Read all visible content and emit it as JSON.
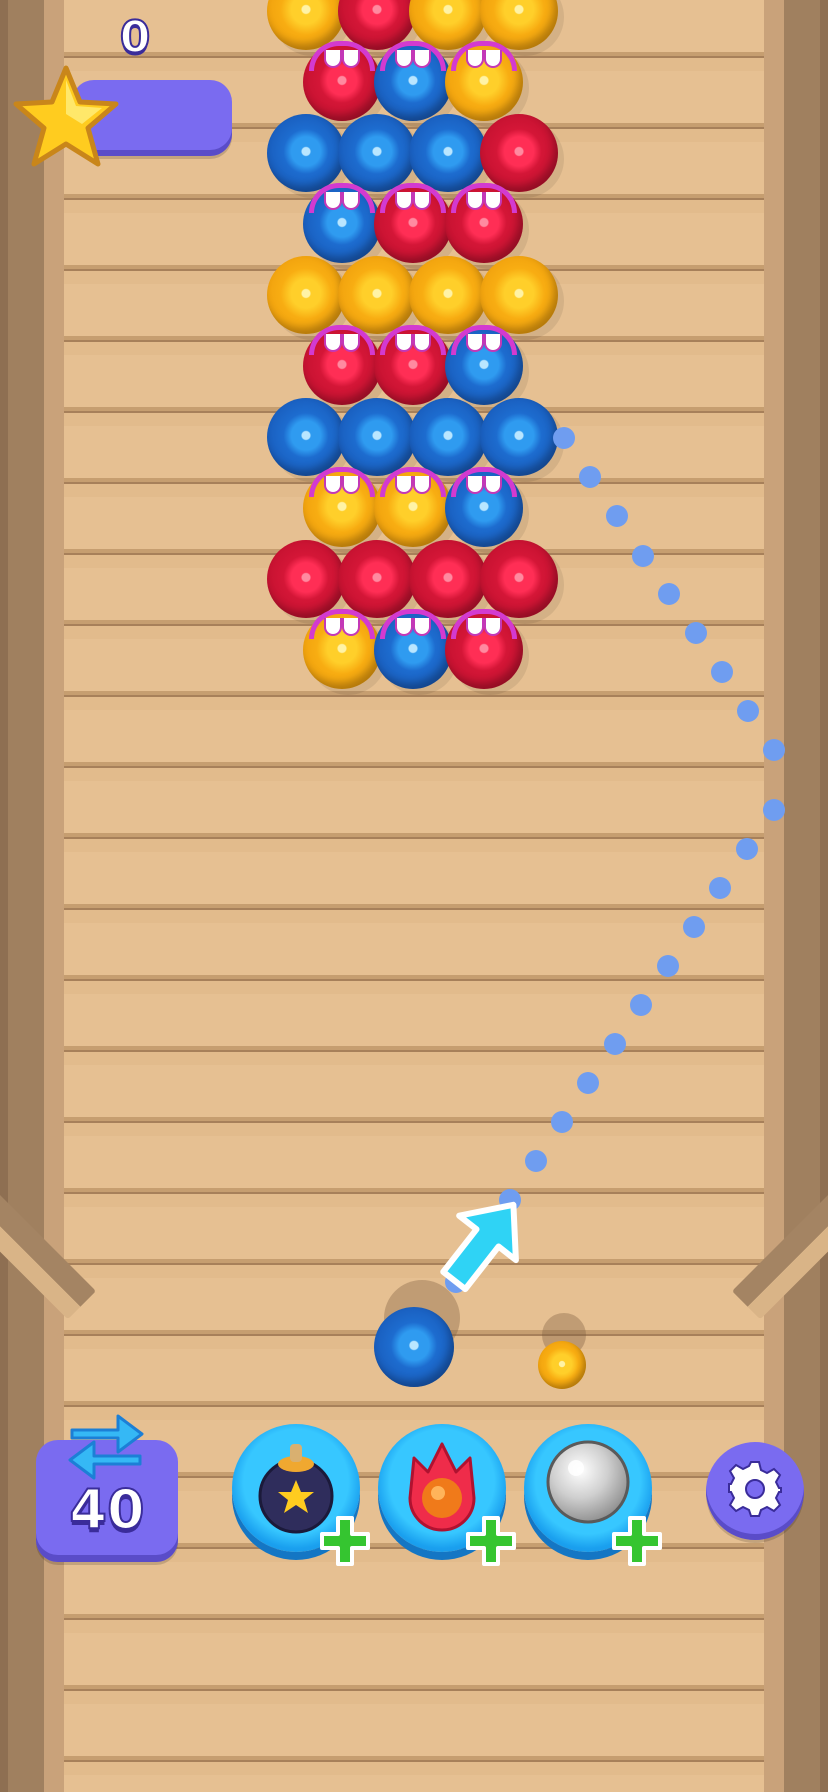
{
  "hud": {
    "score": "0",
    "swaps_remaining": "40"
  },
  "icons": {
    "score": "star-icon",
    "swap": "swap-arrows-icon",
    "settings": "gear-icon",
    "aim": "aim-arrow-icon"
  },
  "powerups": [
    {
      "name": "bomb",
      "icon": "bomb-icon",
      "add_icon": "plus-icon"
    },
    {
      "name": "fire",
      "icon": "fireball-icon",
      "add_icon": "plus-icon"
    },
    {
      "name": "silver",
      "icon": "silver-ball-icon",
      "add_icon": "plus-icon"
    }
  ],
  "shooter": {
    "current_ball": "blue",
    "next_ball": "yellow"
  },
  "bubble_grid": [
    [
      "yellow",
      "red",
      "yellow",
      "yellow"
    ],
    [
      "red-fanged",
      "blue-fanged",
      "yellow-fanged"
    ],
    [
      "blue",
      "blue",
      "blue",
      "red"
    ],
    [
      "blue-fanged",
      "red-fanged",
      "red-fanged"
    ],
    [
      "yellow",
      "yellow",
      "yellow",
      "yellow"
    ],
    [
      "red-fanged",
      "red-fanged",
      "blue-fanged"
    ],
    [
      "blue",
      "blue",
      "blue",
      "blue"
    ],
    [
      "yellow-fanged",
      "yellow-fanged",
      "blue-fanged"
    ],
    [
      "red",
      "red",
      "red",
      "red"
    ],
    [
      "yellow-fanged",
      "blue-fanged",
      "red-fanged"
    ]
  ],
  "colors": {
    "red": "#d41637",
    "blue": "#1d6ccf",
    "yellow": "#f8ad12",
    "panel": "#7a6bf0",
    "powerup": "#1aa0ef",
    "aim_dots": "#6f9df0",
    "aim_arrow": "#2fd3f5",
    "plus": "#35c530",
    "fangs": "#d33ad0"
  }
}
